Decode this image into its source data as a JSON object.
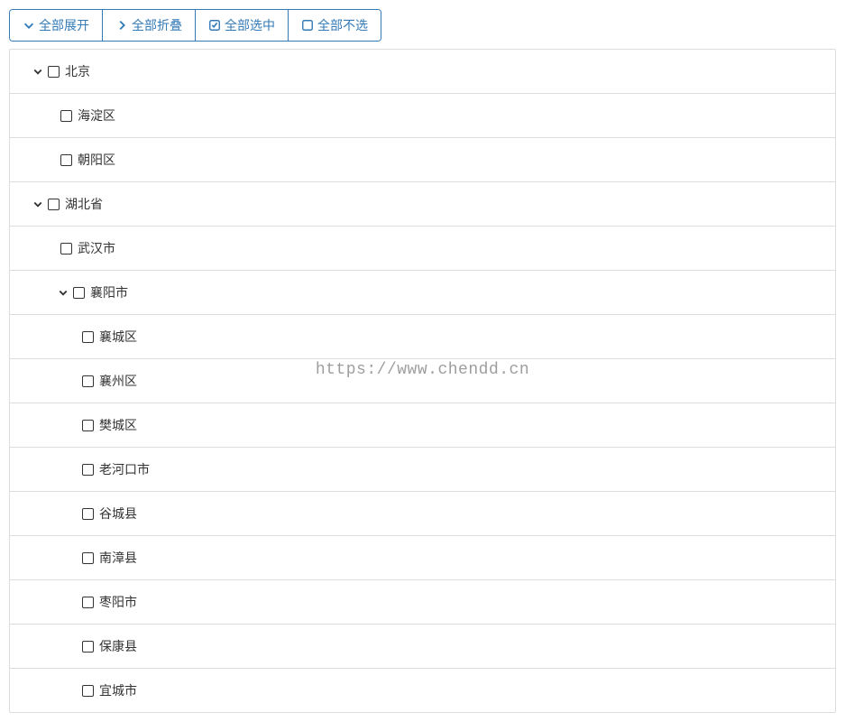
{
  "toolbar": {
    "expand_all": "全部展开",
    "collapse_all": "全部折叠",
    "select_all": "全部选中",
    "deselect_all": "全部不选"
  },
  "tree": {
    "nodes": [
      {
        "label": "北京",
        "level": 0,
        "expandable": true,
        "expanded": true
      },
      {
        "label": "海淀区",
        "level": 1,
        "expandable": false,
        "expanded": false
      },
      {
        "label": "朝阳区",
        "level": 1,
        "expandable": false,
        "expanded": false
      },
      {
        "label": "湖北省",
        "level": 0,
        "expandable": true,
        "expanded": true
      },
      {
        "label": "武汉市",
        "level": 1,
        "expandable": false,
        "expanded": false
      },
      {
        "label": "襄阳市",
        "level": 1,
        "expandable": true,
        "expanded": true
      },
      {
        "label": "襄城区",
        "level": 2,
        "expandable": false,
        "expanded": false
      },
      {
        "label": "襄州区",
        "level": 2,
        "expandable": false,
        "expanded": false
      },
      {
        "label": "樊城区",
        "level": 2,
        "expandable": false,
        "expanded": false
      },
      {
        "label": "老河口市",
        "level": 2,
        "expandable": false,
        "expanded": false
      },
      {
        "label": "谷城县",
        "level": 2,
        "expandable": false,
        "expanded": false
      },
      {
        "label": "南漳县",
        "level": 2,
        "expandable": false,
        "expanded": false
      },
      {
        "label": "枣阳市",
        "level": 2,
        "expandable": false,
        "expanded": false
      },
      {
        "label": "保康县",
        "level": 2,
        "expandable": false,
        "expanded": false
      },
      {
        "label": "宜城市",
        "level": 2,
        "expandable": false,
        "expanded": false
      }
    ]
  },
  "watermark": "https://www.chendd.cn"
}
